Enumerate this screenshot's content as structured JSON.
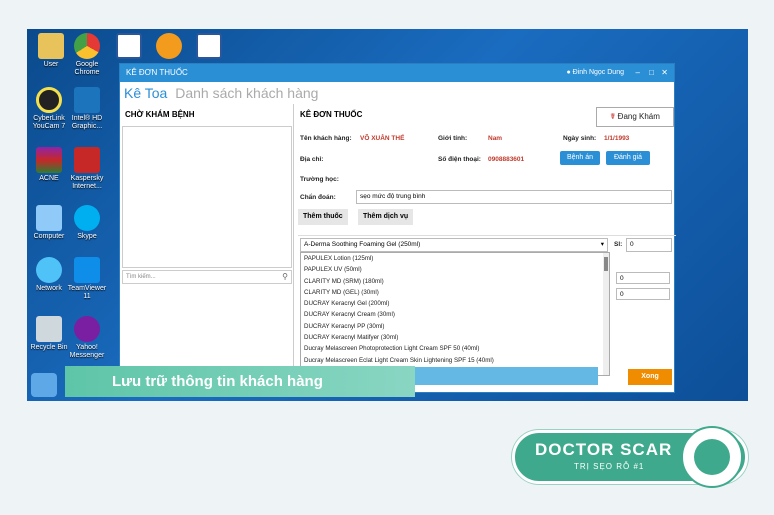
{
  "desktop_icons": [
    {
      "label": "User",
      "icon": "folder-icon"
    },
    {
      "label": "Google Chrome",
      "icon": "chrome-icon"
    },
    {
      "label": "CyberLink YouCam 7",
      "icon": "webcam-icon"
    },
    {
      "label": "Intel® HD Graphic...",
      "icon": "intel-icon"
    },
    {
      "label": "ACNE",
      "icon": "winrar-icon"
    },
    {
      "label": "Kaspersky Internet...",
      "icon": "kaspersky-icon"
    },
    {
      "label": "Computer",
      "icon": "computer-icon"
    },
    {
      "label": "Skype",
      "icon": "skype-icon"
    },
    {
      "label": "Network",
      "icon": "network-icon"
    },
    {
      "label": "TeamViewer 11",
      "icon": "teamviewer-icon"
    },
    {
      "label": "Recycle Bin",
      "icon": "recycle-bin-icon"
    },
    {
      "label": "Yahoo! Messenger",
      "icon": "yahoo-icon"
    }
  ],
  "window": {
    "title": "KÊ ĐƠN THUỐC",
    "user": "Đinh Ngọc Dung",
    "tab_active": "Kê Toa",
    "tab_inactive": "Danh sách khách hàng"
  },
  "left_panel": {
    "title": "CHỜ KHÁM BỆNH",
    "search_placeholder": "Tìm kiếm..."
  },
  "right_panel": {
    "title": "KÊ ĐƠN THUỐC",
    "status_button": "Đang Khám",
    "patient_name_label": "Tên khách hàng:",
    "patient_name": "VÕ XUÂN THẾ",
    "gender_label": "Giới tính:",
    "gender": "Nam",
    "dob_label": "Ngày sinh:",
    "dob": "1/1/1993",
    "address_label": "Địa chỉ:",
    "phone_label": "Số điện thoại:",
    "phone": "0908883601",
    "school_label": "Trường học:",
    "diagnosis_label": "Chẩn đoán:",
    "diagnosis": "sẹo mức độ trung bình",
    "btn_medical_record": "Bệnh án",
    "btn_evaluate": "Đánh giá",
    "subtab_add_medicine": "Thêm thuốc",
    "subtab_add_service": "Thêm dịch vụ",
    "selected_medicine": "A-Derma Soothing Foaming Gel (250ml)",
    "qty_label": "Sl:",
    "qty_value": "0",
    "btn_done": "Xong",
    "dropdown_items": [
      "PAPULEX Lotion (125ml)",
      "PAPULEX UV (50ml)",
      "CLARITY MD (SRM) (180ml)",
      "CLARITY MD (GEL) (30ml)",
      "DUCRAY Keracnyl Gel (200ml)",
      "DUCRAY Keracnyl Cream (30ml)",
      "DUCRAY Keracnyl PP (30ml)",
      "DUCRAY Keracnyl Matifyer (30ml)",
      "Ducray Melascreen Photoprotection Light Cream SPF 50 (40ml)",
      "Ducray Melascreen Eclat Light Cream Skin Lightening SPF 15 (40ml)"
    ]
  },
  "banner": {
    "text": "Lưu trữ thông tin khách hàng"
  },
  "brand": {
    "title": "DOCTOR SCAR",
    "subtitle": "TRỊ SẸO RỖ #1",
    "color": "#3fa98e"
  }
}
